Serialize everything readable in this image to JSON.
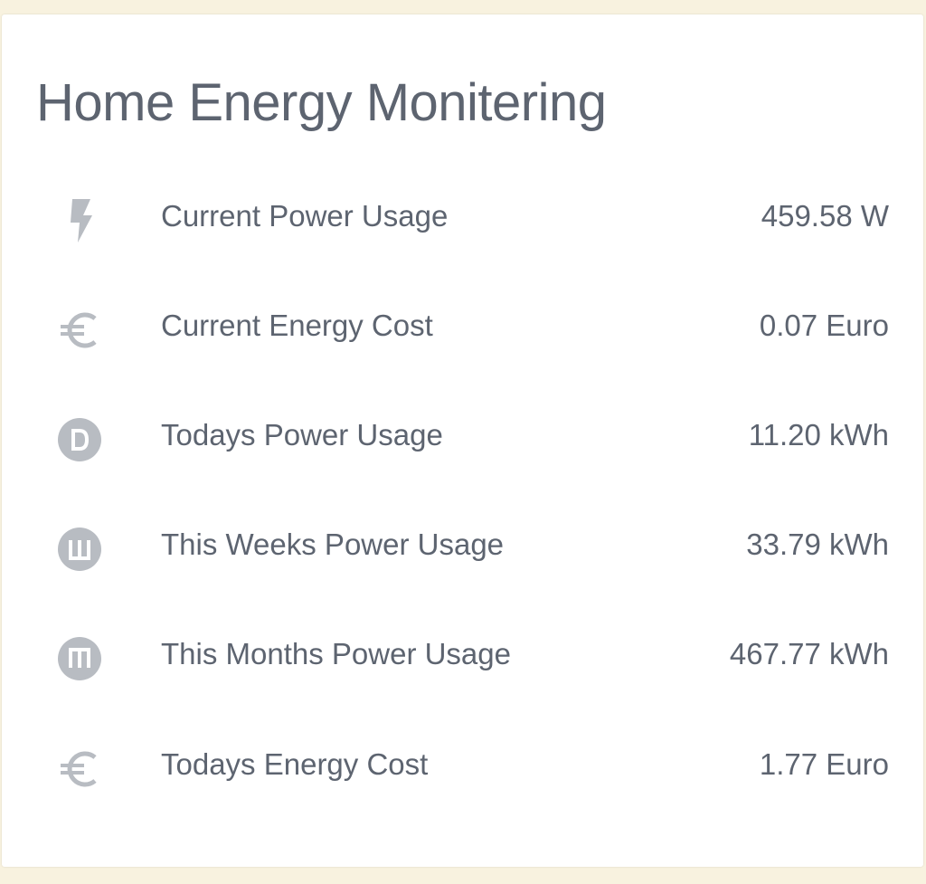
{
  "card": {
    "title": "Home Energy Monitering",
    "rows": [
      {
        "icon": "flash-icon",
        "label": "Current Power Usage",
        "value": "459.58 W"
      },
      {
        "icon": "euro-icon",
        "label": "Current Energy Cost",
        "value": "0.07 Euro"
      },
      {
        "icon": "alpha-d-circle-icon",
        "label": "Todays Power Usage",
        "value": "11.20 kWh"
      },
      {
        "icon": "alpha-w-circle-icon",
        "label": "This Weeks Power Usage",
        "value": "33.79 kWh"
      },
      {
        "icon": "alpha-m-circle-icon",
        "label": "This Months Power Usage",
        "value": "467.77 kWh"
      },
      {
        "icon": "euro-icon",
        "label": "Todays Energy Cost",
        "value": "1.77 Euro"
      }
    ]
  },
  "colors": {
    "page_background": "#f8f2df",
    "card_background": "#ffffff",
    "text": "#5d6470",
    "icon": "#b8bcc2"
  }
}
